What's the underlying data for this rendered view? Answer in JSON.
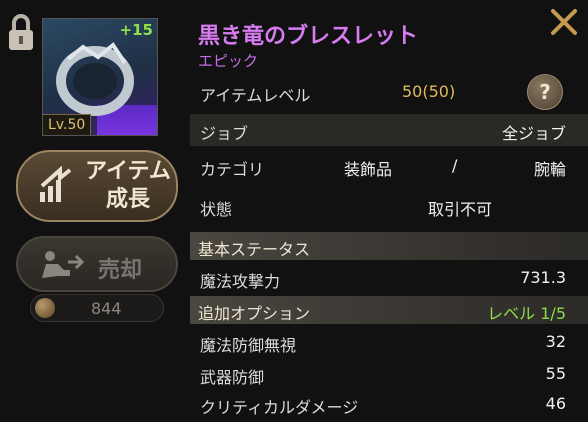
{
  "item": {
    "name": "黒き竜のブレスレット",
    "rarity": "エピック",
    "enhance": "+15",
    "level_badge": "Lv.50"
  },
  "buttons": {
    "grow_line1": "アイテム",
    "grow_line2": "成長",
    "sell": "売却",
    "sell_price": "844"
  },
  "info": {
    "item_level_label": "アイテムレベル",
    "item_level_value": "50(50)",
    "help_label": "?",
    "job_label": "ジョブ",
    "job_value": "全ジョブ",
    "category_label": "カテゴリ",
    "category_value1": "装飾品",
    "category_sep": "/",
    "category_value2": "腕輪",
    "state_label": "状態",
    "state_value": "取引不可"
  },
  "base_stats": {
    "header": "基本ステータス",
    "items": [
      {
        "label": "魔法攻撃力",
        "value": "731.3"
      }
    ]
  },
  "extra_options": {
    "header": "追加オプション",
    "level": "レベル 1/5",
    "items": [
      {
        "label": "魔法防御無視",
        "value": "32"
      },
      {
        "label": "武器防御",
        "value": "55"
      },
      {
        "label": "クリティカルダメージ",
        "value": "46"
      }
    ]
  },
  "colors": {
    "title": "#d77cf0",
    "accent_gold": "#e3b860",
    "option_green": "#8cdc4a"
  },
  "icons": {
    "lock": "lock-icon",
    "close": "close-icon",
    "help": "help-icon",
    "grow": "grow-icon",
    "sell": "sell-icon",
    "coin": "coin-icon"
  }
}
